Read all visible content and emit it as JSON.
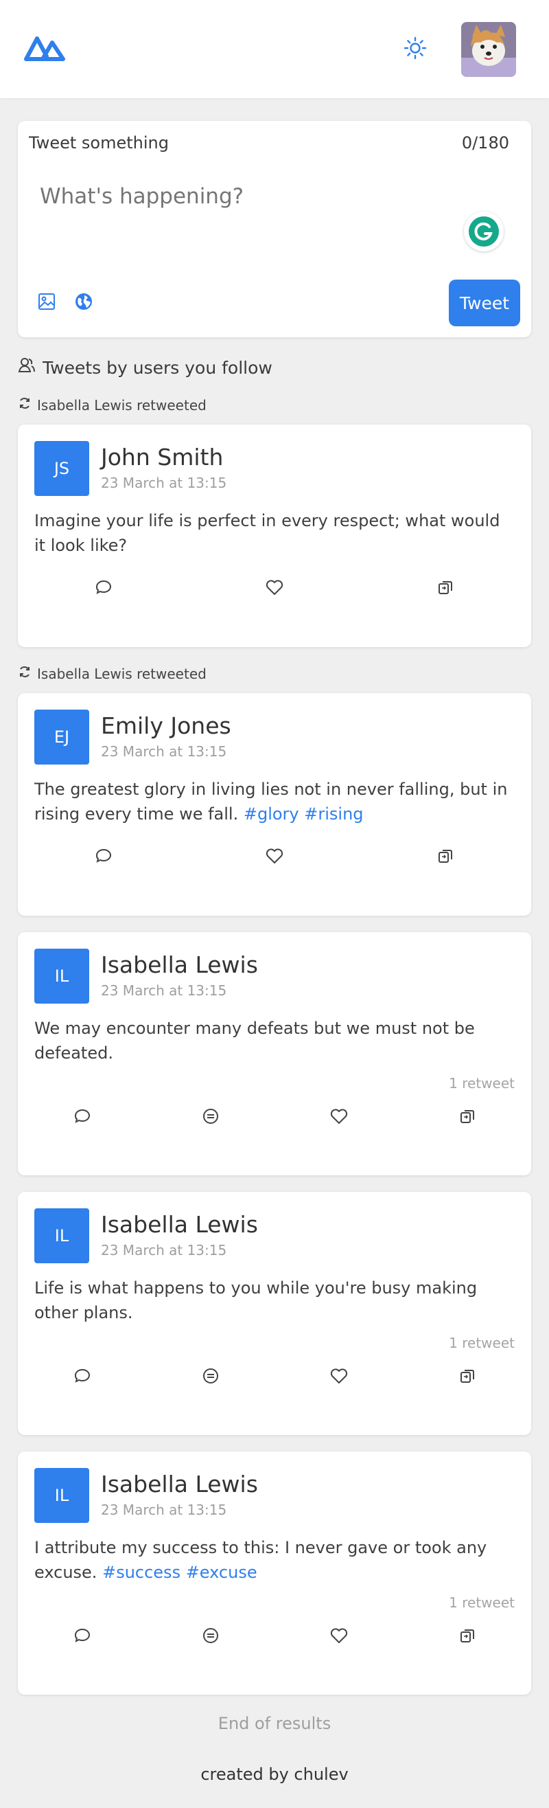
{
  "header": {
    "logo_icon": "app-logo-icon",
    "theme_icon": "sun-icon",
    "avatar_icon": "user-avatar"
  },
  "compose": {
    "title": "Tweet something",
    "counter": "0/180",
    "placeholder": "What's happening?",
    "tweet_label": "Tweet",
    "icons": [
      "image-icon",
      "globe-icon",
      "grammarly-icon"
    ]
  },
  "feed_title": "Tweets by users you follow",
  "tweets": [
    {
      "retweeted_by": "Isabella Lewis retweeted",
      "initials": "JS",
      "name": "John Smith",
      "date": "23 March at 13:15",
      "text": "Imagine your life is perfect in every respect; what would it look like?",
      "tags": "",
      "meta": ""
    },
    {
      "retweeted_by": "Isabella Lewis retweeted",
      "initials": "EJ",
      "name": "Emily Jones",
      "date": "23 March at 13:15",
      "text": "The greatest glory in living lies not in never falling, but in rising every time we fall.",
      "tags": "#glory #rising",
      "meta": ""
    },
    {
      "retweeted_by": "",
      "initials": "IL",
      "name": "Isabella Lewis",
      "date": "23 March at 13:15",
      "text": "We may encounter many defeats but we must not be defeated.",
      "tags": "",
      "meta": "1 retweet"
    },
    {
      "retweeted_by": "",
      "initials": "IL",
      "name": "Isabella Lewis",
      "date": "23 March at 13:15",
      "text": "Life is what happens to you while you're busy making other plans.",
      "tags": "",
      "meta": "1 retweet"
    },
    {
      "retweeted_by": "",
      "initials": "IL",
      "name": "Isabella Lewis",
      "date": "23 March at 13:15",
      "text": "I attribute my success to this: I never gave or took any excuse.",
      "tags": "#success #excuse",
      "meta": "1 retweet"
    }
  ],
  "end_text": "End of results",
  "footer_text": "created by chulev",
  "colors": {
    "accent": "#2f7fec",
    "background": "#efefef"
  }
}
